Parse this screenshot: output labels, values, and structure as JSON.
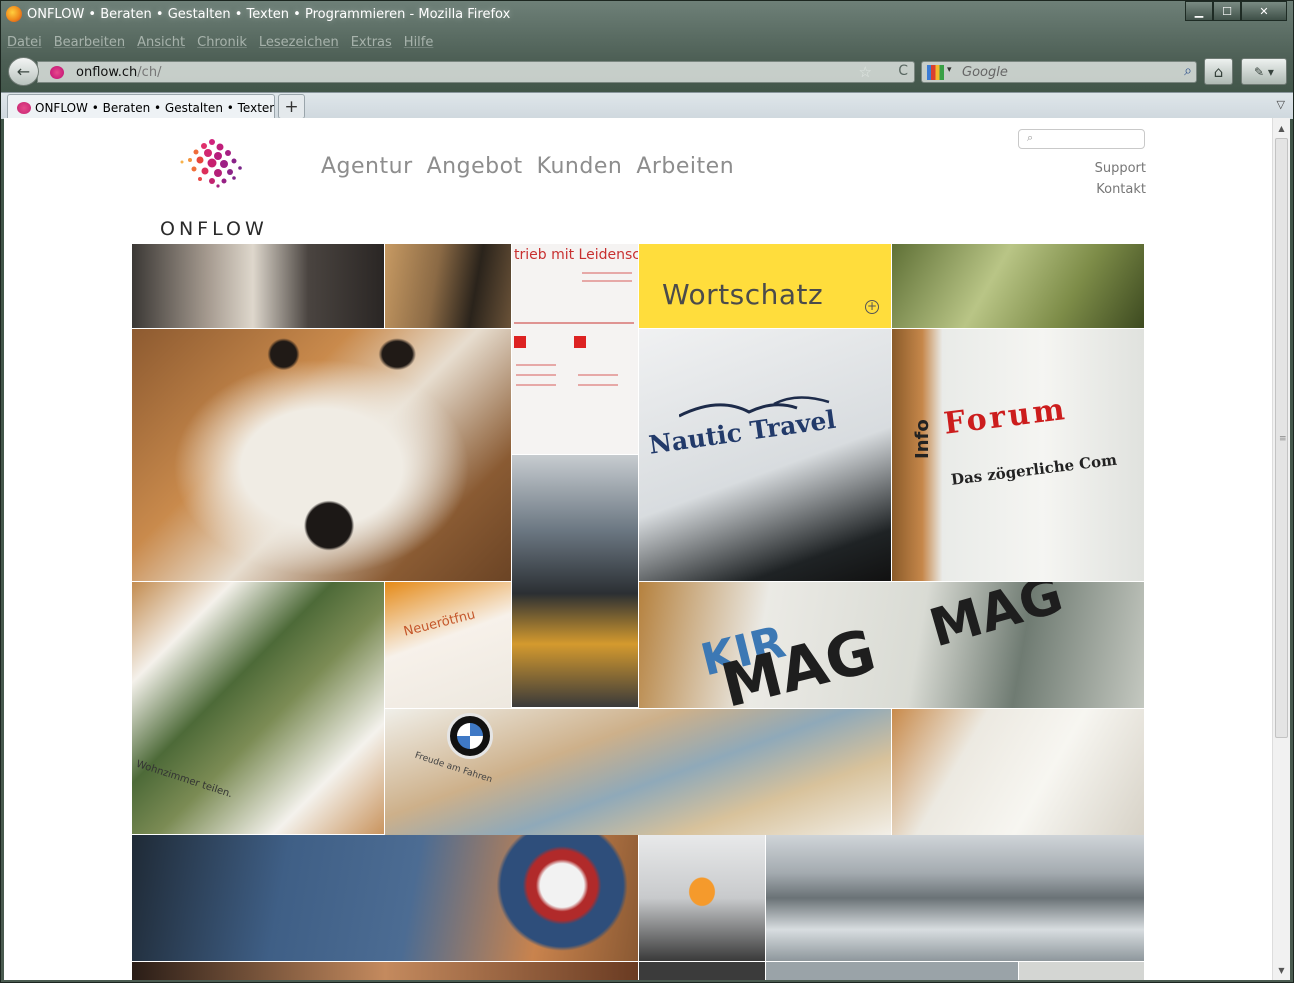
{
  "window": {
    "title": "ONFLOW • Beraten • Gestalten • Texten • Programmieren - Mozilla Firefox",
    "minimize": "▁",
    "maximize": "☐",
    "close": "✕"
  },
  "menubar": [
    "Datei",
    "Bearbeiten",
    "Ansicht",
    "Chronik",
    "Lesezeichen",
    "Extras",
    "Hilfe"
  ],
  "navbar": {
    "back": "←",
    "url_host": "onflow.ch",
    "url_path": "/ch/",
    "star": "☆",
    "reload": "C",
    "search_placeholder": "Google",
    "search_engine_arrow": "▾",
    "search_go": "⌕",
    "home": "⌂",
    "addon": "✎ ▾"
  },
  "tabs": {
    "active_label": "ONFLOW • Beraten • Gestalten • Texten ...",
    "new_tab": "+",
    "list": "▽"
  },
  "page": {
    "logo_text": "ONFLOW",
    "nav": [
      "Agentur",
      "Angebot",
      "Kunden",
      "Arbeiten"
    ],
    "search_icon": "⌕",
    "utility": [
      "Support",
      "Kontakt"
    ],
    "tiles": {
      "flyer_headline": "trieb mit Leidensch",
      "wortschatz": "Wortschatz",
      "nautic": "Nautic Travel",
      "forum_title": "Forum",
      "forum_info": "Info",
      "forum_sub": "Das zögerliche Com",
      "poster_caption": "Wohnzimmer teilen.",
      "card_text": "Neuerötfnu",
      "kir": "KIR",
      "mag": "MAG",
      "mag2": "MAG",
      "bmw_caption": "Freude am Fahren"
    }
  },
  "scrollbar": {
    "up": "▲",
    "down": "▼",
    "grip": "≡"
  },
  "colors": {
    "accent_magenta": "#d0247d",
    "nav_gray": "#8d8d8d",
    "wortschatz_yellow": "#ffdd3c",
    "forum_red": "#cc1d1d"
  }
}
